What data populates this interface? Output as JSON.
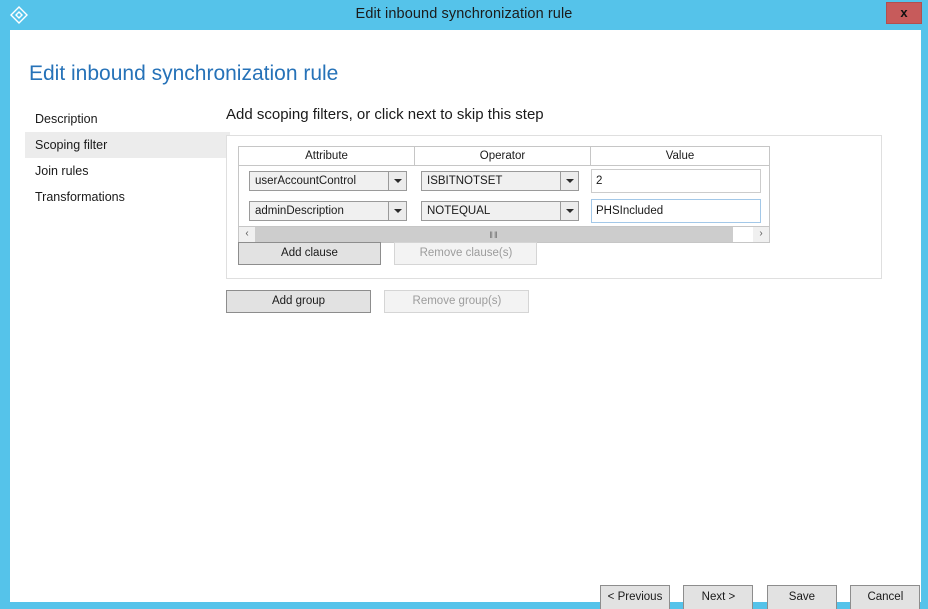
{
  "window": {
    "title": "Edit inbound synchronization rule",
    "icon": "sync-rule-diamond-icon",
    "close_label": "x",
    "titlebar_color": "#55c3ea",
    "close_color": "#c75b5b"
  },
  "page": {
    "heading": "Edit inbound synchronization rule",
    "heading_color": "#2672b8"
  },
  "sidebar": {
    "items": [
      {
        "label": "Description",
        "selected": false
      },
      {
        "label": "Scoping filter",
        "selected": true
      },
      {
        "label": "Join rules",
        "selected": false
      },
      {
        "label": "Transformations",
        "selected": false
      }
    ]
  },
  "main": {
    "instruction": "Add scoping filters, or click next to skip this step",
    "grid": {
      "columns": [
        "Attribute",
        "Operator",
        "Value"
      ],
      "rows": [
        {
          "attribute": "userAccountControl",
          "operator": "ISBITNOTSET",
          "value": "2",
          "value_focused": false
        },
        {
          "attribute": "adminDescription",
          "operator": "NOTEQUAL",
          "value": "PHSIncluded",
          "value_focused": true
        }
      ],
      "scrollbar": {
        "left_arrow": "‹",
        "right_arrow": "›",
        "grip": "‖‖"
      }
    },
    "clause_buttons": [
      {
        "label": "Add clause",
        "disabled": false
      },
      {
        "label": "Remove clause(s)",
        "disabled": true
      }
    ],
    "group_buttons": [
      {
        "label": "Add group",
        "disabled": false
      },
      {
        "label": "Remove group(s)",
        "disabled": true
      }
    ]
  },
  "footer": {
    "buttons": [
      {
        "label": "< Previous"
      },
      {
        "label": "Next >"
      },
      {
        "label": "Save"
      },
      {
        "label": "Cancel"
      }
    ]
  }
}
